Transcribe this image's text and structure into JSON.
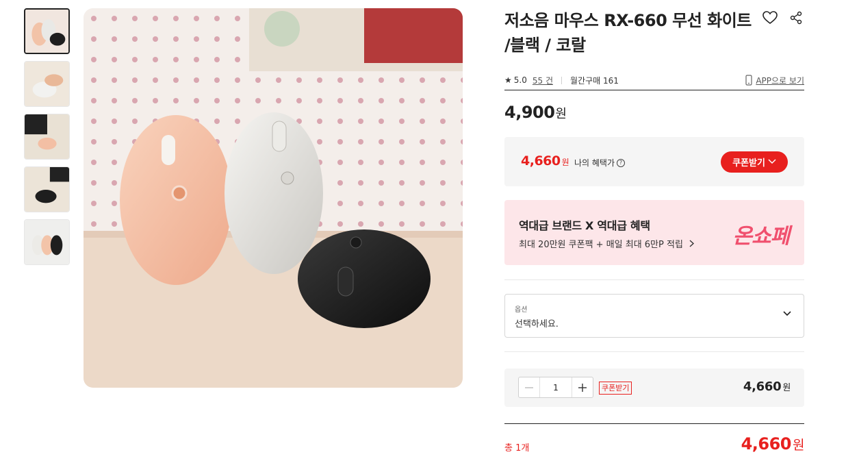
{
  "product": {
    "title": "저소음 마우스 RX-660 무선 화이트 /블랙 / 코랄",
    "rating": "5.0",
    "review_count": "55 건",
    "monthly_purchase": "월간구매 161",
    "app_link": "APP으로 보기"
  },
  "price": {
    "value": "4,900",
    "unit": "원"
  },
  "benefit": {
    "price": "4,660",
    "unit": "원",
    "label": "나의 혜택가",
    "coupon_button": "쿠폰받기"
  },
  "promo": {
    "title": "역대급 브랜드 X 역대급 혜택",
    "subtitle": "최대 20만원 쿠폰팩 + 매일 최대 6만P 적립",
    "logo": "온쇼페"
  },
  "option": {
    "label": "옵션",
    "value": "선택하세요."
  },
  "quantity": {
    "value": "1",
    "coupon_tag": "쿠폰받기",
    "price": "4,660",
    "unit": "원"
  },
  "total": {
    "label": "총 1개",
    "price": "4,660",
    "unit": "원"
  },
  "colors": {
    "accent_red": "#e8201e",
    "promo_bg": "#fde6e9",
    "promo_logo": "#f0506e"
  },
  "icons": [
    "heart-icon",
    "share-icon",
    "star-icon",
    "mobile-icon",
    "help-icon",
    "chevron-down-icon",
    "minus-icon",
    "plus-icon"
  ]
}
